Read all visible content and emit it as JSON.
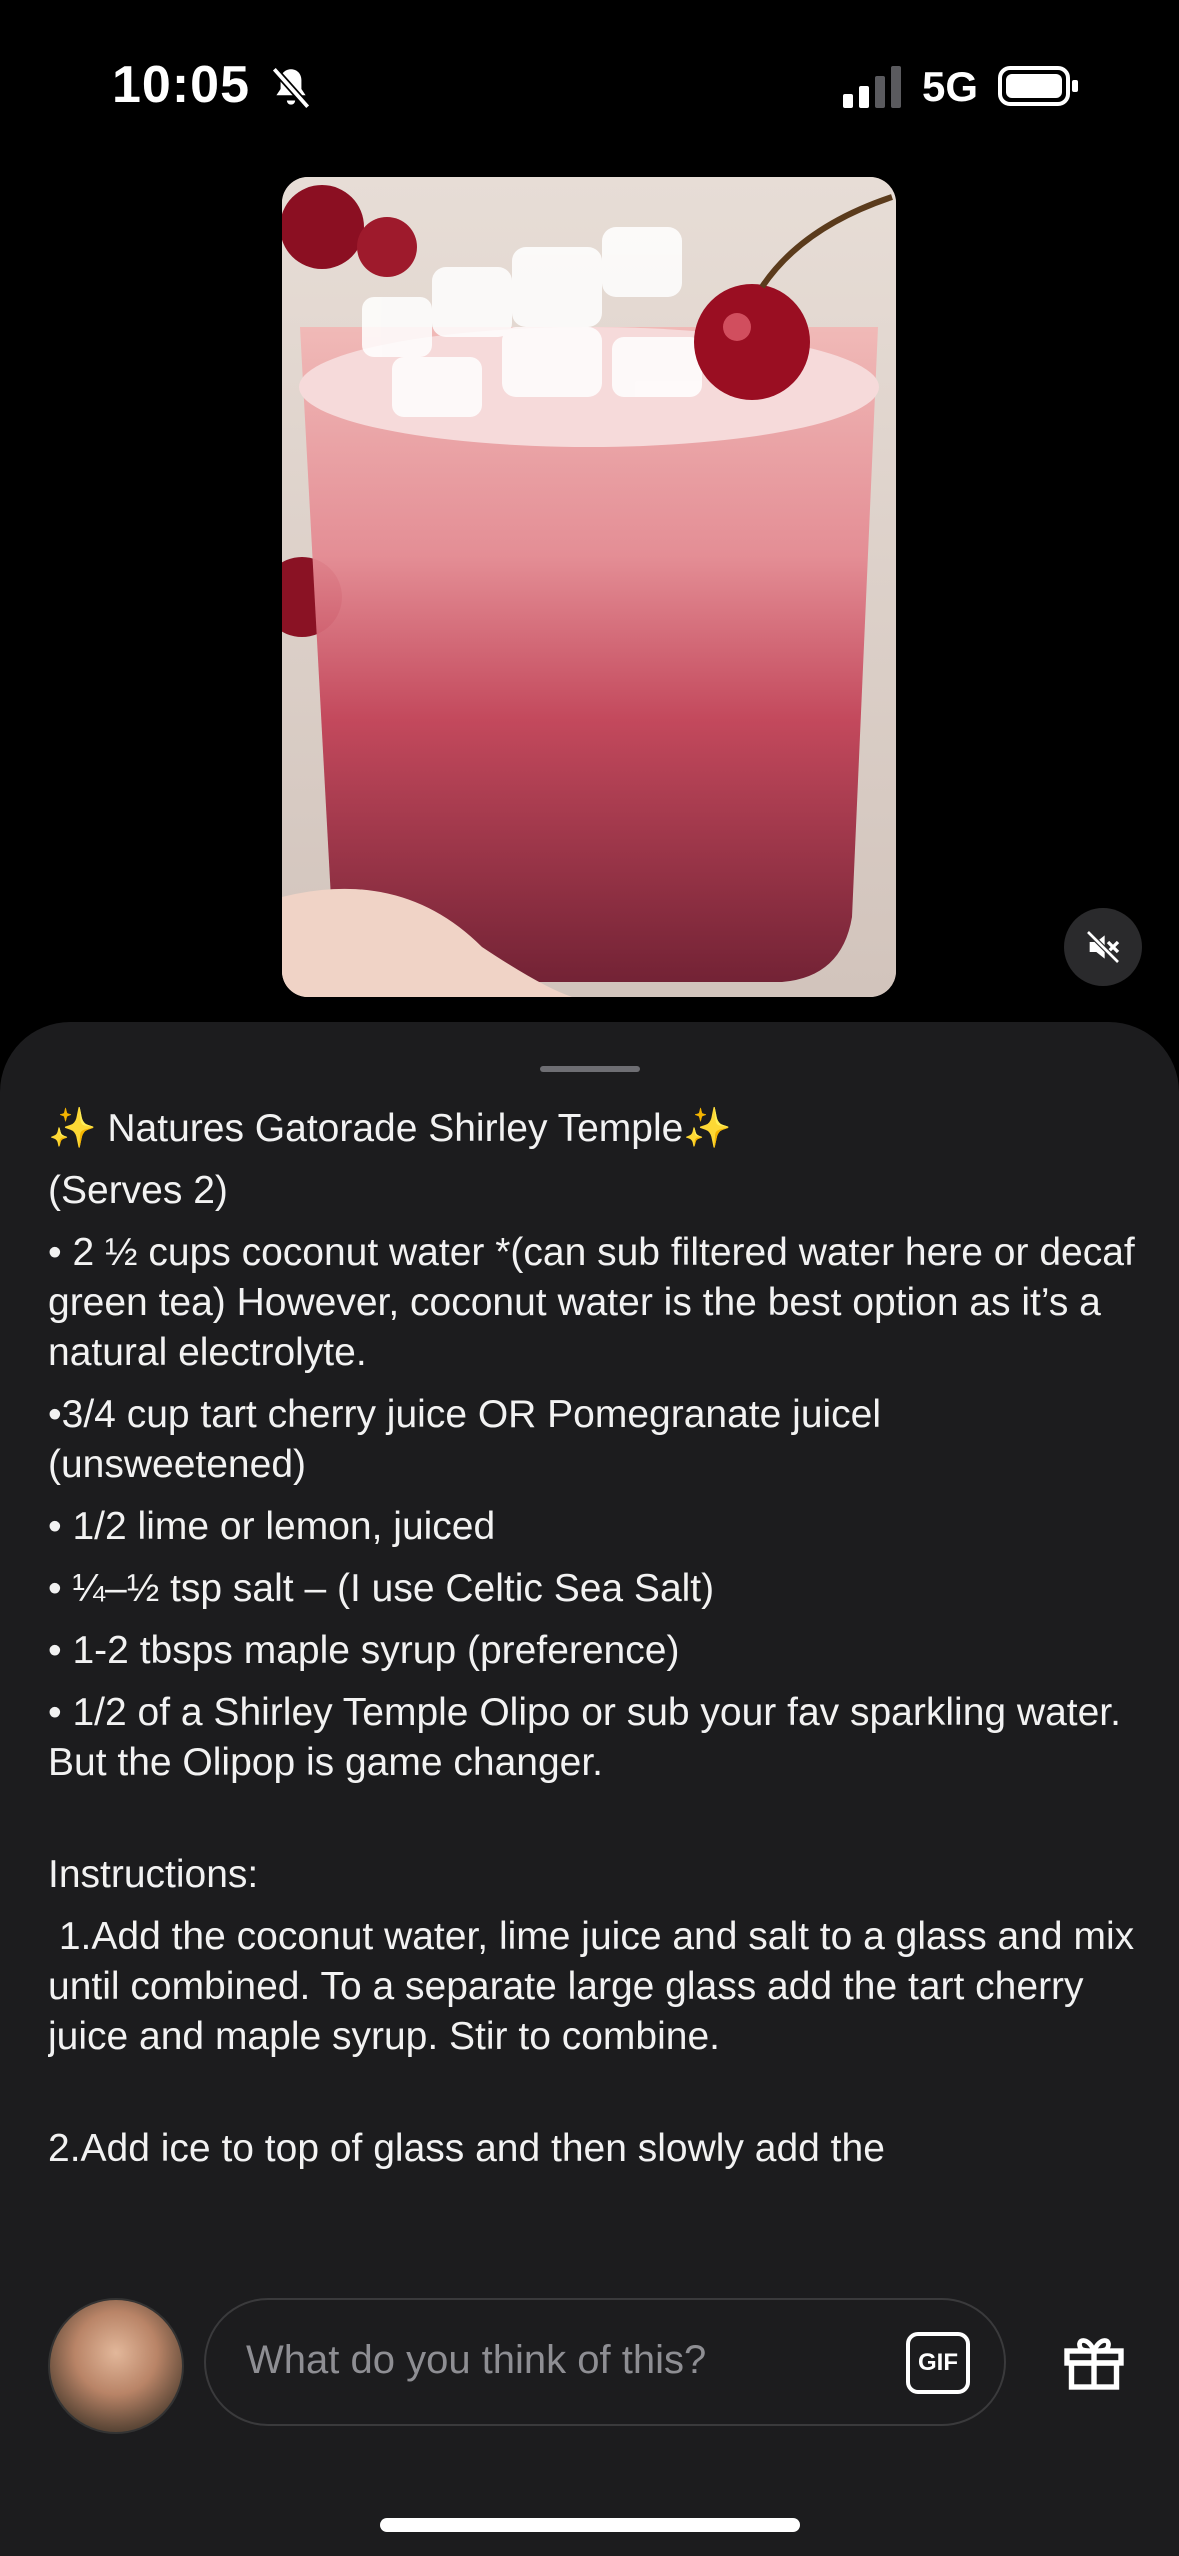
{
  "status_bar": {
    "time": "10:05",
    "network": "5G",
    "icons": [
      "bell-slash-icon",
      "signal-icon",
      "battery-icon"
    ]
  },
  "media": {
    "description_icon": "mute-icon"
  },
  "caption": {
    "lines": [
      "✨ Natures Gatorade Shirley Temple✨",
      "(Serves 2)",
      "• 2 ½ cups coconut water *(can sub filtered water here or decaf green tea) However, coconut water is the best option as it’s a natural electrolyte.",
      "•3/4 cup tart cherry juice OR Pomegranate juicel (unsweetened)",
      "• 1/2 lime or lemon, juiced",
      "• ¼–½ tsp salt – (I use Celtic Sea Salt)",
      "• 1-2 tbsps maple syrup (preference)",
      "• 1/2 of a Shirley Temple Olipo or sub your fav sparkling water. But the Olipop is game changer.",
      "Instructions:",
      " 1.Add the coconut water, lime juice and salt to a glass and mix until combined. To a separate large glass add the tart cherry juice and maple syrup. Stir to combine.",
      "2.Add ice to top of glass and then slowly add the"
    ]
  },
  "composer": {
    "placeholder": "What do you think of this?",
    "gif_label": "GIF"
  },
  "colors": {
    "background": "#000000",
    "sheet": "#1c1c1e",
    "placeholder": "#8e8e93"
  }
}
